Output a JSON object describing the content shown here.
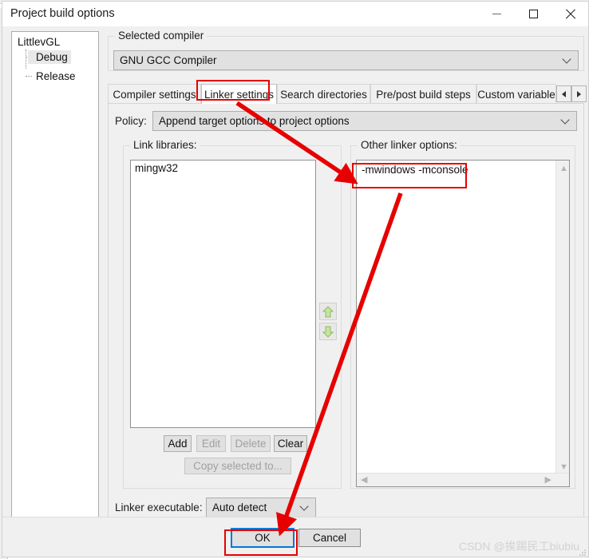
{
  "window": {
    "title": "Project build options",
    "controls": {
      "minimize": "minimize-icon",
      "maximize": "maximize-icon",
      "close": "close-icon"
    }
  },
  "tree": {
    "root": "LittlevGL",
    "children": [
      {
        "label": "Debug",
        "selected": true
      },
      {
        "label": "Release",
        "selected": false
      }
    ]
  },
  "selected_compiler": {
    "legend": "Selected compiler",
    "value": "GNU GCC Compiler",
    "chevron": "chevron-down-icon"
  },
  "tabs": {
    "items": [
      {
        "label": "Compiler settings",
        "active": false
      },
      {
        "label": "Linker settings",
        "active": true
      },
      {
        "label": "Search directories",
        "active": false
      },
      {
        "label": "Pre/post build steps",
        "active": false
      },
      {
        "label": "Custom variable",
        "active": false
      }
    ],
    "scroll_left": "triangle-left-icon",
    "scroll_right": "triangle-right-icon"
  },
  "policy": {
    "label": "Policy:",
    "value": "Append target options to project options",
    "chevron": "chevron-down-icon"
  },
  "link_libraries": {
    "legend": "Link libraries:",
    "items": [
      "mingw32"
    ],
    "buttons": [
      {
        "label": "Add",
        "disabled": false
      },
      {
        "label": "Edit",
        "disabled": true
      },
      {
        "label": "Delete",
        "disabled": true
      },
      {
        "label": "Clear",
        "disabled": false
      }
    ],
    "copy_button": {
      "label": "Copy selected to...",
      "disabled": true
    },
    "move_up_icon": "arrow-up-icon",
    "move_down_icon": "arrow-down-icon"
  },
  "other_linker_options": {
    "legend": "Other linker options:",
    "value": "-mwindows -mconsole",
    "scroll_up_icon": "chevron-up-icon",
    "scroll_down_icon": "chevron-down-icon",
    "scroll_left_icon": "chevron-left-icon",
    "scroll_right_icon": "chevron-right-icon"
  },
  "linker_executable": {
    "label": "Linker executable:",
    "value": "Auto detect",
    "chevron": "chevron-down-icon"
  },
  "footer": {
    "ok": "OK",
    "cancel": "Cancel"
  },
  "annotations": {
    "accent_color": "#e60000",
    "highlight_tab": "Linker settings",
    "highlight_options": "-mwindows -mconsole",
    "highlight_ok": "OK"
  },
  "watermark": {
    "text": "CSDN @挨踢民工biubiu"
  }
}
